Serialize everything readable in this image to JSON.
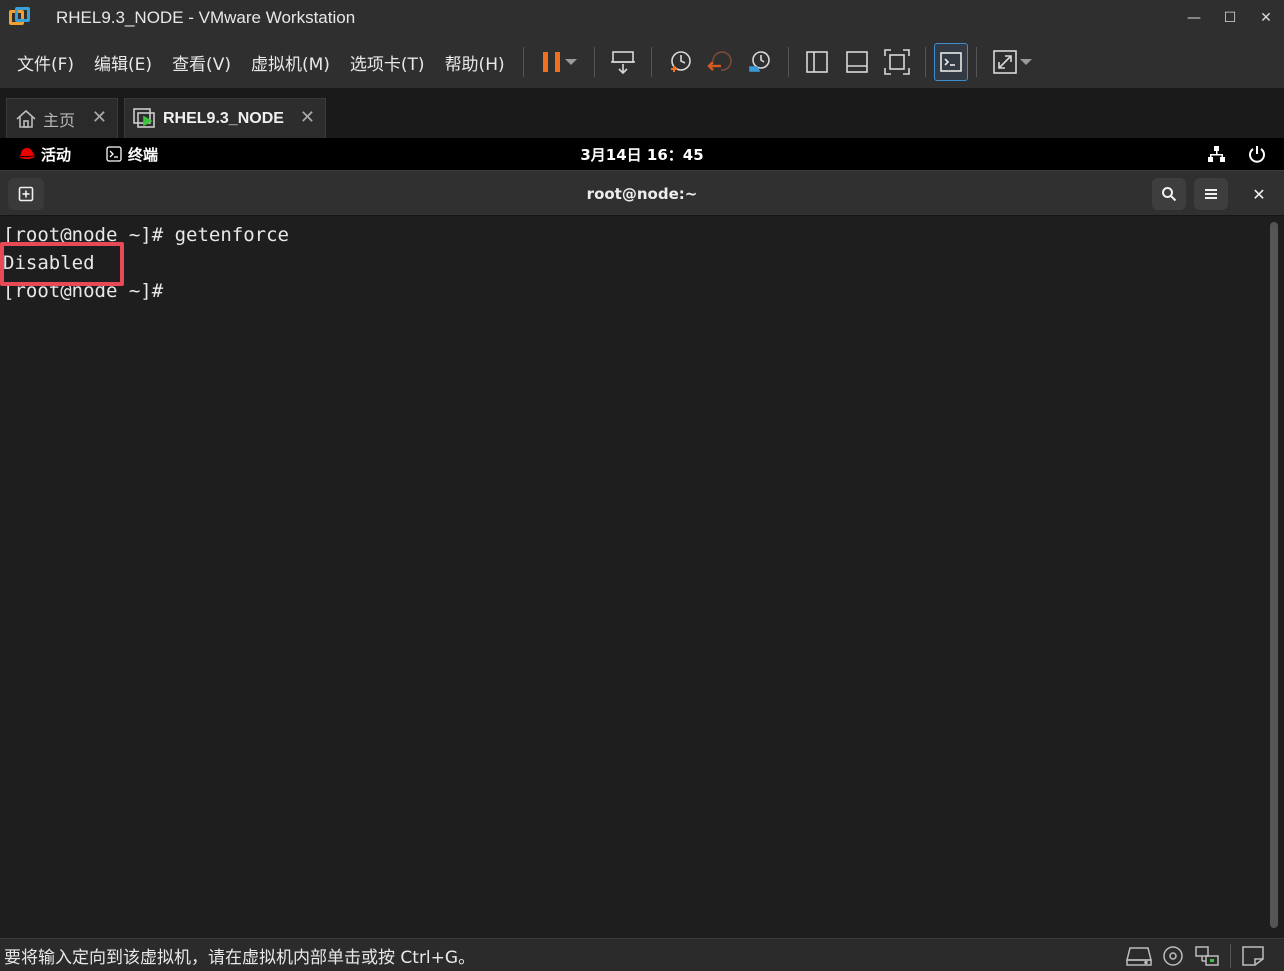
{
  "window": {
    "title": "RHEL9.3_NODE - VMware Workstation",
    "minimize": "—",
    "maximize": "☐",
    "close": "✕"
  },
  "menu": {
    "items": [
      "文件(F)",
      "编辑(E)",
      "查看(V)",
      "虚拟机(M)",
      "选项卡(T)",
      "帮助(H)"
    ]
  },
  "toolbar": {
    "icons": [
      "pause-icon",
      "send-keys-icon",
      "snapshot-icon",
      "revert-snapshot-icon",
      "snapshot-manager-icon",
      "library-icon",
      "console-view-icon",
      "fullscreen-icon",
      "terminal-icon",
      "stretch-icon"
    ],
    "colors": {
      "pause": "#f07020",
      "revert": "#d85a20",
      "accent": "#3a8fd0"
    }
  },
  "tabs": [
    {
      "label": "主页",
      "icon": "home-icon"
    },
    {
      "label": "RHEL9.3_NODE",
      "icon": "vm-running-icon"
    }
  ],
  "gnome": {
    "activities": "活动",
    "app": "终端",
    "clock": "3月14日  16：45"
  },
  "terminal": {
    "title": "root@node:~",
    "lines": [
      "[root@node ~]# getenforce",
      "Disabled",
      "[root@node ~]#"
    ],
    "highlight_color": "#e84a55"
  },
  "status": {
    "text": "要将输入定向到该虚拟机，请在虚拟机内部单击或按 Ctrl+G。",
    "icons": [
      "hard-disk-icon",
      "cd-rom-icon",
      "network-icon",
      "message-icon"
    ]
  }
}
